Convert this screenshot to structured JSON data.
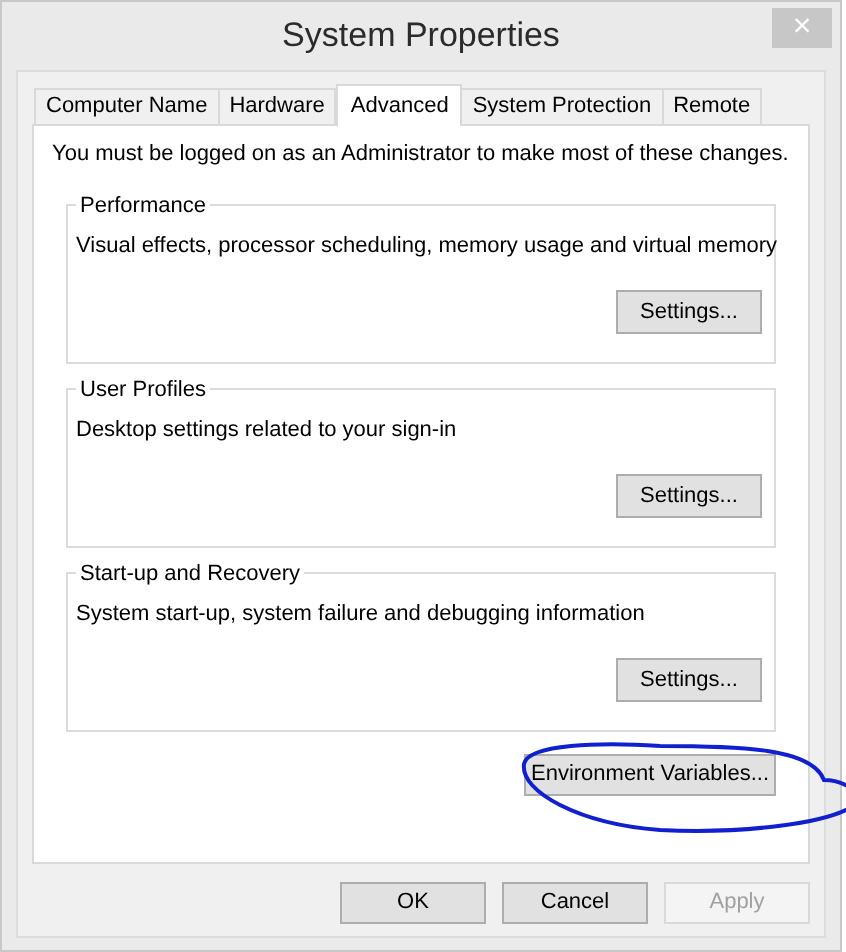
{
  "window": {
    "title": "System Properties",
    "close": "×"
  },
  "tabs": [
    {
      "label": "Computer Name",
      "selected": false
    },
    {
      "label": "Hardware",
      "selected": false
    },
    {
      "label": "Advanced",
      "selected": true
    },
    {
      "label": "System Protection",
      "selected": false
    },
    {
      "label": "Remote",
      "selected": false
    }
  ],
  "notice": "You must be logged on as an Administrator to make most of these changes.",
  "groups": [
    {
      "title": "Performance",
      "description": "Visual effects, processor scheduling, memory usage and virtual memory",
      "button": "Settings..."
    },
    {
      "title": "User Profiles",
      "description": "Desktop settings related to your sign-in",
      "button": "Settings..."
    },
    {
      "title": "Start-up and Recovery",
      "description": "System start-up, system failure and debugging information",
      "button": "Settings..."
    }
  ],
  "environment_button": {
    "label": "Environment Variables...",
    "circled": true
  },
  "buttons": [
    {
      "label": "OK",
      "disabled": false
    },
    {
      "label": "Cancel",
      "disabled": false
    },
    {
      "label": "Apply",
      "disabled": true
    }
  ]
}
